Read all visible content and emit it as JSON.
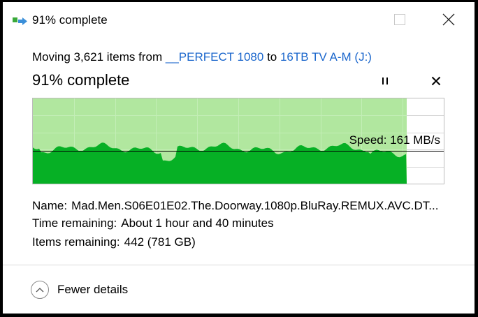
{
  "window": {
    "title": "91% complete"
  },
  "progress": {
    "source_prefix": "Moving 3,621 items from ",
    "source": "__PERFECT 1080",
    "to_word": " to ",
    "destination": "16TB TV A-M (J:)",
    "percent_text": "91% complete",
    "percent_value": 91
  },
  "graph": {
    "speed_text": "Speed: 161 MB/s",
    "fill_color": "#06b025",
    "background_fill_color": "#a8e495"
  },
  "details": {
    "name_label": "Name:",
    "name_value": "Mad.Men.S06E01E02.The.Doorway.1080p.BluRay.REMUX.AVC.DT...",
    "time_label": "Time remaining:",
    "time_value": "About 1 hour and 40 minutes",
    "items_label": "Items remaining:",
    "items_value": "442 (781 GB)"
  },
  "footer": {
    "toggle_label": "Fewer details"
  },
  "colors": {
    "link": "#1a66cc",
    "progress_green": "#06b025",
    "progress_light_green": "#a8e495"
  },
  "icons": {
    "app": "file-move-icon",
    "minimize": "minimize-icon",
    "maximize": "maximize-icon",
    "close": "close-icon",
    "pause": "pause-icon",
    "cancel": "cancel-icon",
    "toggle": "chevron-up-icon"
  }
}
